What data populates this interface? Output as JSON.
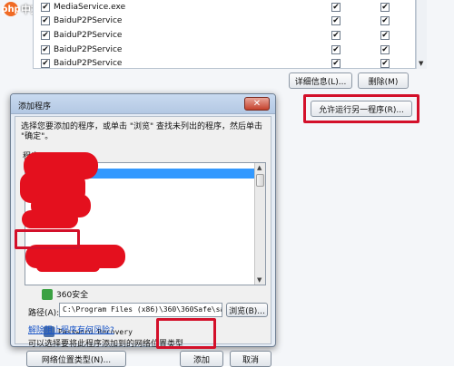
{
  "watermark": {
    "badge": "php",
    "text": "中文网"
  },
  "firewall_list": {
    "rows": [
      {
        "name": "MediaService.exe",
        "col1": true,
        "col2": true,
        "col3": true
      },
      {
        "name": "BaiduP2PService",
        "col1": true,
        "col2": true,
        "col3": true
      },
      {
        "name": "BaiduP2PService",
        "col1": true,
        "col2": true,
        "col3": true
      },
      {
        "name": "BaiduP2PService",
        "col1": true,
        "col2": true,
        "col3": true
      },
      {
        "name": "BaiduP2PService",
        "col1": true,
        "col2": true,
        "col3": true
      }
    ],
    "check_glyph": "✔"
  },
  "buttons": {
    "details": "详细信息(L)...",
    "remove": "删除(M)",
    "allow_another": "允许运行另一程序(R)..."
  },
  "dialog": {
    "title": "添加程序",
    "close_glyph": "✕",
    "instruction": "选择您要添加的程序，或单击 \"浏览\" 查找未列出的程序，然后单击 \"确定\"。",
    "programs_label": "程序(P):",
    "programs": [
      {
        "label": "360安全",
        "icon_color": "#3aa142"
      },
      {
        "label": "Password Recovery",
        "icon_color": "#4a6fa8"
      }
    ],
    "path_label": "路径(A):",
    "path_value": "C:\\Program Files (x86)\\360\\360Safe\\sa",
    "browse": "浏览(B)...",
    "risk_link": "解除阻止程序有何风险?",
    "network_text": "可以选择要将此程序添加到的网络位置类型",
    "network_button": "网络位置类型(N)...",
    "add": "添加",
    "cancel": "取消"
  },
  "colors": {
    "highlight_red": "#d3102a",
    "selection_blue": "#3399ff",
    "link_blue": "#1a56c8"
  }
}
